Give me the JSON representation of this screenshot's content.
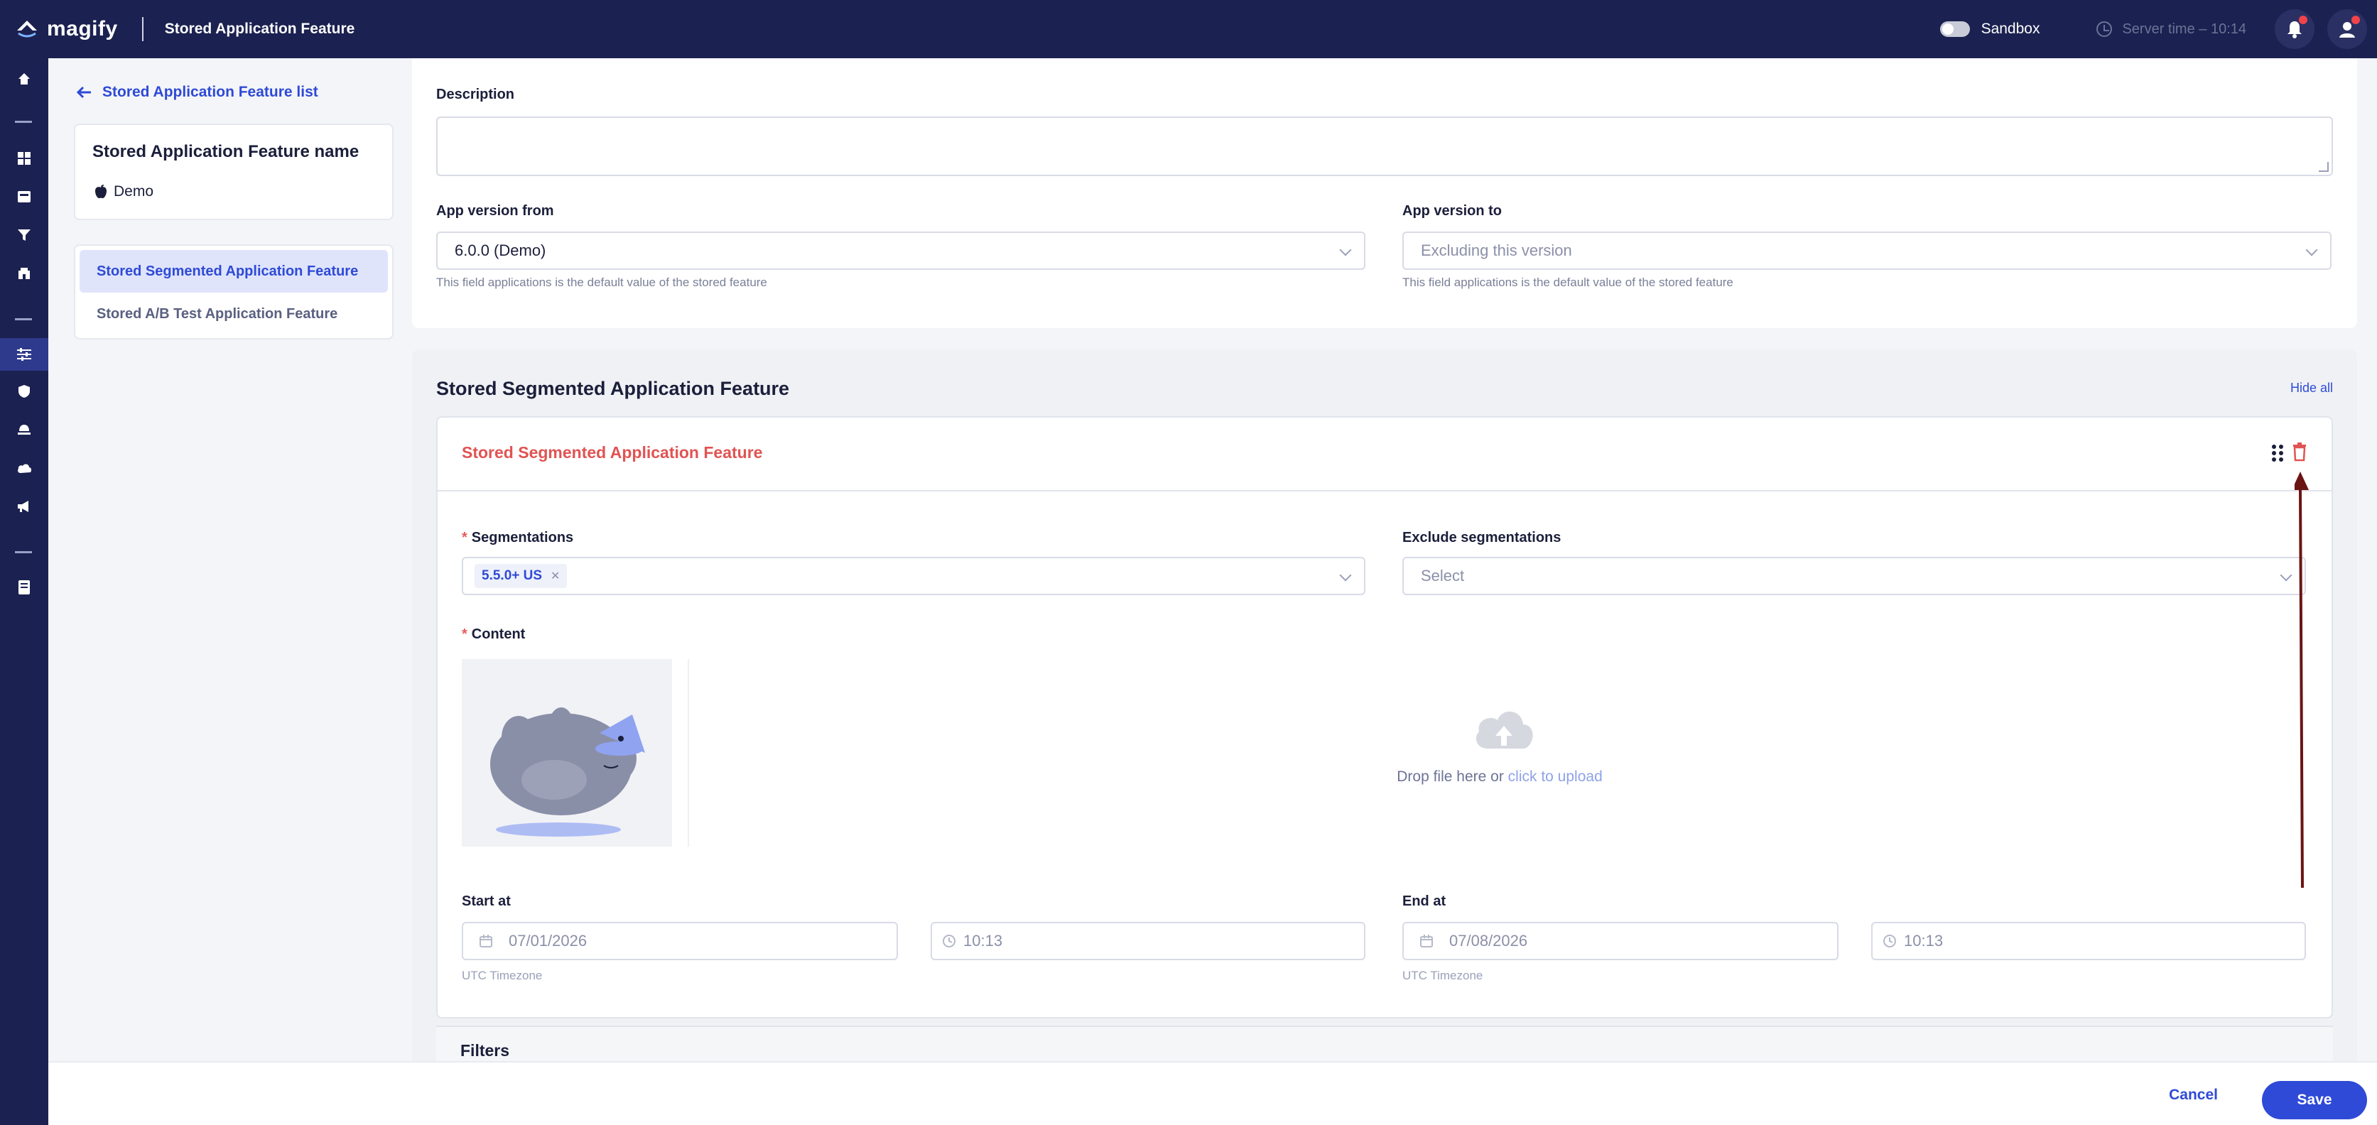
{
  "app": {
    "brand": "magify",
    "page_title": "Stored Application Feature"
  },
  "topbar": {
    "sandbox_label": "Sandbox",
    "server_time": "Server time – 10:14"
  },
  "left_panel": {
    "back_link": "Stored Application Feature list",
    "name_card": {
      "title": "Stored Application Feature name",
      "platform": "Demo"
    },
    "nav": [
      {
        "label": "Stored Segmented Application Feature",
        "active": true
      },
      {
        "label": "Stored A/B Test Application Feature",
        "active": false
      }
    ]
  },
  "form": {
    "description_label": "Description",
    "description_value": "",
    "version_from": {
      "label": "App version from",
      "value": "6.0.0 (Demo)",
      "hint": "This field applications is the default value of the stored feature"
    },
    "version_to": {
      "label": "App version to",
      "placeholder": "Excluding this version",
      "hint": "This field applications is the default value of the stored feature"
    }
  },
  "segment_section": {
    "title": "Stored Segmented Application Feature",
    "hide_all": "Hide all",
    "card": {
      "title": "Stored Segmented Application Feature",
      "segmentations_label": "Segmentations",
      "segmentation_tags": [
        "5.5.0+ US"
      ],
      "exclude_label": "Exclude segmentations",
      "exclude_placeholder": "Select",
      "content_label": "Content",
      "upload_text": "Drop file here or",
      "upload_link": "click to upload",
      "start_label": "Start at",
      "start_date": "07/01/2026",
      "start_time": "10:13",
      "end_label": "End at",
      "end_date": "07/08/2026",
      "end_time": "10:13",
      "timezone_note": "UTC Timezone"
    },
    "filters_label": "Filters"
  },
  "footer": {
    "cancel": "Cancel",
    "save": "Save"
  },
  "colors": {
    "topbar": "#1b2150",
    "accent": "#2e4ad6",
    "danger": "#e15353",
    "annotation_arrow": "#6b1414"
  }
}
